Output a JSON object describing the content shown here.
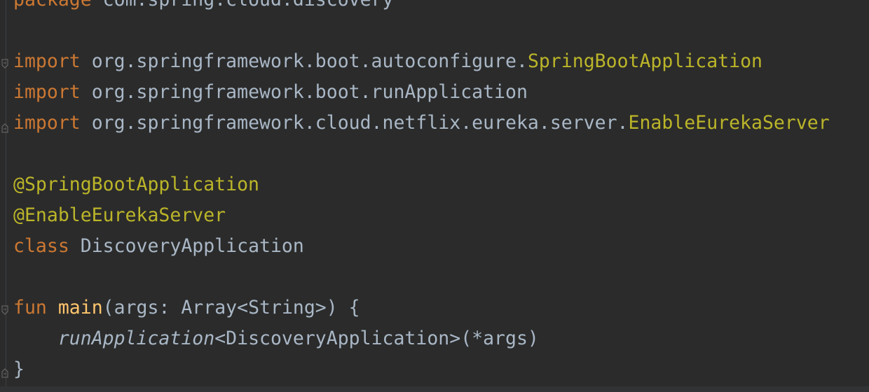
{
  "editor": {
    "lines": {
      "package": {
        "keyword": "package",
        "name": "com.spring.cloud.discovery"
      },
      "import1": {
        "keyword": "import",
        "path": "org.springframework.boot.autoconfigure.",
        "symbol": "SpringBootApplication"
      },
      "import2": {
        "keyword": "import",
        "path": "org.springframework.boot.runApplication"
      },
      "import3": {
        "keyword": "import",
        "path": "org.springframework.cloud.netflix.eureka.server.",
        "symbol": "EnableEurekaServer"
      },
      "ann1": "@SpringBootApplication",
      "ann2": "@EnableEurekaServer",
      "classDecl": {
        "keyword": "class",
        "name": "DiscoveryApplication"
      },
      "funDecl": {
        "keyword": "fun",
        "name": "main",
        "params": "(args: Array<String>) {"
      },
      "call": {
        "indent": "    ",
        "fn": "runApplication",
        "rest": "<DiscoveryApplication>(*args)"
      },
      "close": "}"
    },
    "colors": {
      "background": "#2b2b2b",
      "keyword": "#cc7832",
      "annotation": "#bbb529",
      "text": "#a9b7c6",
      "function": "#ffc66d"
    }
  }
}
